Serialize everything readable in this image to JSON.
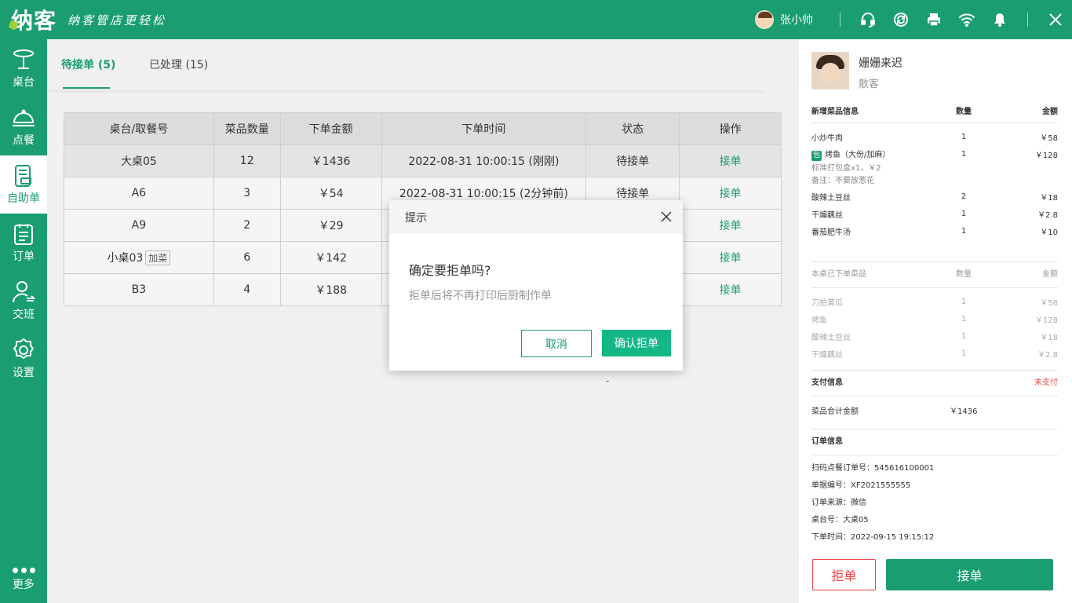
{
  "header": {
    "logo": "纳客",
    "slogan": "纳客管店更轻松",
    "user_name": "张小帅",
    "icons": [
      "headset-icon",
      "sync-icon",
      "printer-icon",
      "wifi-icon",
      "bell-icon",
      "close-icon"
    ]
  },
  "sidebar": {
    "items": [
      {
        "label": "桌台",
        "icon": "table-icon"
      },
      {
        "label": "点餐",
        "icon": "cloche-icon"
      },
      {
        "label": "自助单",
        "icon": "self-order-icon",
        "active": true
      },
      {
        "label": "订单",
        "icon": "clipboard-icon"
      },
      {
        "label": "交班",
        "icon": "handover-icon"
      },
      {
        "label": "设置",
        "icon": "gear-icon"
      }
    ],
    "more_label": "更多"
  },
  "tabs": {
    "pending": "待接单 (5)",
    "processed": "已处理 (15)"
  },
  "table": {
    "headers": [
      "桌台/取餐号",
      "菜品数量",
      "下单金额",
      "下单时间",
      "状态",
      "操作"
    ],
    "rows": [
      {
        "table": "大桌05",
        "tag": "",
        "qty": "12",
        "amount": "￥1436",
        "time": "2022-08-31 10:00:15 (刚刚)",
        "status": "待接单",
        "action": "接单"
      },
      {
        "table": "A6",
        "tag": "",
        "qty": "3",
        "amount": "￥54",
        "time": "2022-08-31 10:00:15 (2分钟前)",
        "status": "待接单",
        "action": "接单"
      },
      {
        "table": "A9",
        "tag": "",
        "qty": "2",
        "amount": "￥29",
        "time": "",
        "status": "",
        "action": "接单"
      },
      {
        "table": "小桌03",
        "tag": "加菜",
        "qty": "6",
        "amount": "￥142",
        "time": "",
        "status": "",
        "action": "接单"
      },
      {
        "table": "B3",
        "tag": "",
        "qty": "4",
        "amount": "￥188",
        "time": "",
        "status": "",
        "action": "接单"
      }
    ]
  },
  "panel": {
    "customer_name": "姗姗来迟",
    "customer_type": "散客",
    "new_items": {
      "title": "新增菜品信息",
      "qty_label": "数量",
      "amount_label": "金额",
      "items": [
        {
          "name": "小炒牛肉",
          "qty": "1",
          "amount": "￥58"
        },
        {
          "name": "烤鱼（大份/加麻）",
          "badge": "包",
          "qty": "1",
          "amount": "￥128",
          "sub1": "标准打包盒x1，￥2",
          "sub2": "备注：不要放葱花"
        },
        {
          "name": "酸辣土豆丝",
          "qty": "2",
          "amount": "￥18"
        },
        {
          "name": "干煸藕丝",
          "qty": "1",
          "amount": "￥2.8"
        },
        {
          "name": "番茄肥牛汤",
          "qty": "1",
          "amount": "￥10"
        }
      ]
    },
    "ordered_items": {
      "title": "本桌已下单菜品",
      "qty_label": "数量",
      "amount_label": "金额",
      "items": [
        {
          "name": "刀拍黄瓜",
          "qty": "1",
          "amount": "￥58"
        },
        {
          "name": "烤鱼",
          "qty": "1",
          "amount": "￥128"
        },
        {
          "name": "酸辣土豆丝",
          "qty": "1",
          "amount": "￥18"
        },
        {
          "name": "干煸藕丝",
          "qty": "1",
          "amount": "￥2.8"
        }
      ]
    },
    "payment": {
      "title": "支付信息",
      "status": "未支付",
      "total_label": "菜品合计金额",
      "total_value": "￥1436"
    },
    "order_info": {
      "title": "订单信息",
      "lines": [
        "扫码点餐订单号：545616100001",
        "单据编号：XF2021555555",
        "订单来源：微信",
        "桌台号：大桌05",
        "下单时间：2022-09-15 19:15:12"
      ]
    },
    "reject_label": "拒单",
    "accept_label": "接单"
  },
  "dialog": {
    "header": "提示",
    "title": "确定要拒单吗?",
    "message": "拒单后将不再打印后厨制作单",
    "cancel_label": "取消",
    "confirm_label": "确认拒单"
  },
  "stray_text": "-",
  "colors": {
    "brand": "#1a9d6f",
    "danger": "#ee4444",
    "confirm": "#14b884"
  }
}
